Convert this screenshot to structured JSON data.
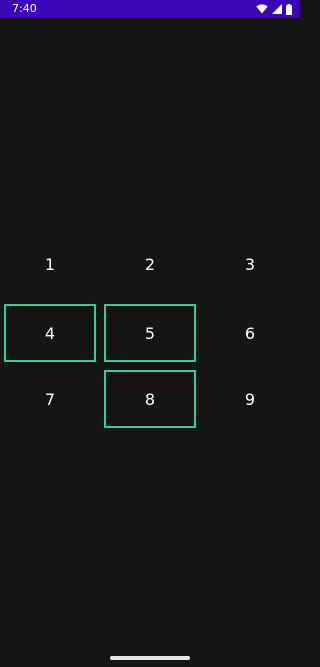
{
  "status_bar": {
    "time": "7:40",
    "background": "#3a06b8",
    "icons": [
      "wifi-icon",
      "signal-icon",
      "battery-icon"
    ]
  },
  "theme": {
    "background": "#151515",
    "text": "#ffffff",
    "selection_border": "#2ed19a"
  },
  "grid": {
    "cells": [
      {
        "label": "1",
        "selected": false
      },
      {
        "label": "2",
        "selected": false
      },
      {
        "label": "3",
        "selected": false
      },
      {
        "label": "4",
        "selected": true
      },
      {
        "label": "5",
        "selected": true
      },
      {
        "label": "6",
        "selected": false
      },
      {
        "label": "7",
        "selected": false
      },
      {
        "label": "8",
        "selected": true
      },
      {
        "label": "9",
        "selected": false
      }
    ]
  }
}
